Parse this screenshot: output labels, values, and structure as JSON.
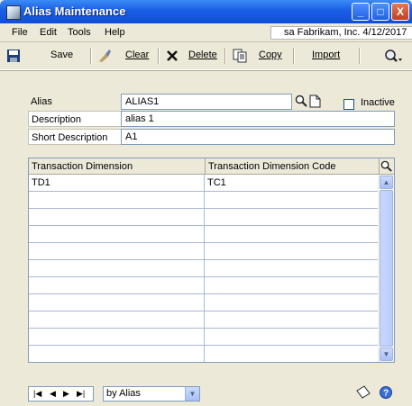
{
  "window": {
    "title": "Alias Maintenance",
    "controls": {
      "minimize": "_",
      "maximize": "□",
      "close": "X"
    }
  },
  "menu": {
    "items": [
      "File",
      "Edit",
      "Tools",
      "Help"
    ],
    "user_info": "sa Fabrikam, Inc. 4/12/2017"
  },
  "toolbar": {
    "save_label": "Save",
    "clear_label": "Clear",
    "delete_label": "Delete",
    "copy_label": "Copy",
    "import_label": "Import"
  },
  "form": {
    "alias_label": "Alias",
    "alias_value": "ALIAS1",
    "inactive_label": "Inactive",
    "description_label": "Description",
    "description_value": "alias 1",
    "short_description_label": "Short Description",
    "short_description_value": "A1"
  },
  "grid": {
    "columns": [
      "Transaction Dimension",
      "Transaction Dimension Code"
    ],
    "rows": [
      [
        "TD1",
        "TC1"
      ],
      [
        "",
        ""
      ],
      [
        "",
        ""
      ],
      [
        "",
        ""
      ],
      [
        "",
        ""
      ],
      [
        "",
        ""
      ],
      [
        "",
        ""
      ],
      [
        "",
        ""
      ],
      [
        "",
        ""
      ],
      [
        "",
        ""
      ],
      [
        "",
        ""
      ]
    ]
  },
  "footer": {
    "sort_by": "by Alias"
  },
  "colors": {
    "title_bar": "#1a5ee5",
    "window_bg": "#ece9d8",
    "field_border": "#7f9db9"
  }
}
